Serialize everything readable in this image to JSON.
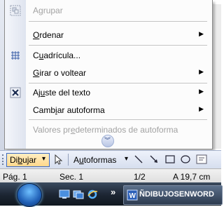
{
  "menu": {
    "items": [
      {
        "id": "agrupar",
        "pre": "A",
        "ul": "g",
        "post": "rupar",
        "disabled": true,
        "submenu": false,
        "icon": "group-icon"
      },
      {
        "id": "ordenar",
        "pre": "",
        "ul": "O",
        "post": "rdenar",
        "disabled": false,
        "submenu": true,
        "icon": ""
      },
      {
        "id": "cuadricula",
        "pre": "C",
        "ul": "u",
        "post": "adrícula...",
        "disabled": false,
        "submenu": false,
        "icon": "grid-icon"
      },
      {
        "id": "girar",
        "pre": "",
        "ul": "G",
        "post": "irar o voltear",
        "disabled": false,
        "submenu": true,
        "icon": ""
      },
      {
        "id": "ajuste",
        "pre": "Aj",
        "ul": "u",
        "post": "ste del texto",
        "disabled": false,
        "submenu": true,
        "icon": "text-wrap-icon"
      },
      {
        "id": "cambiar",
        "pre": "Camb",
        "ul": "i",
        "post": "ar autoforma",
        "disabled": false,
        "submenu": true,
        "icon": ""
      },
      {
        "id": "valores",
        "pre": "Valores pr",
        "ul": "e",
        "post": "determinados de autoforma",
        "disabled": true,
        "submenu": false,
        "icon": ""
      }
    ],
    "expand_icon": "double-chevron-down-icon"
  },
  "toolbar": {
    "dibujar_pre": "Di",
    "dibujar_ul": "b",
    "dibujar_post": "ujar",
    "dibujar_arrow": "▾",
    "select_icon": "pointer-arrow-icon",
    "autoformas_ul": "u",
    "autoformas_pre": "A",
    "autoformas_post": "toformas",
    "autoformas_arrow": "▾",
    "tools": [
      "line-icon",
      "arrow-icon",
      "rectangle-icon",
      "oval-icon",
      "textbox-icon"
    ]
  },
  "statusbar": {
    "page": "Pág. 1",
    "section": "Sec. 1",
    "pages": "1/2",
    "position": "A 19,7 cm"
  },
  "taskbar": {
    "start_icon": "windows-start-icon",
    "quick_launch": [
      "show-desktop-icon",
      "window-switch-icon",
      "internet-explorer-icon"
    ],
    "overflow": "»",
    "task_label": "ÑDIBUJOSENWORD",
    "task_icon": "word-document-icon"
  },
  "colors": {
    "menu_highlight": "#ffd88b",
    "toolbar_bg": "#d6deee",
    "taskbar_bg": "#1c2532"
  }
}
